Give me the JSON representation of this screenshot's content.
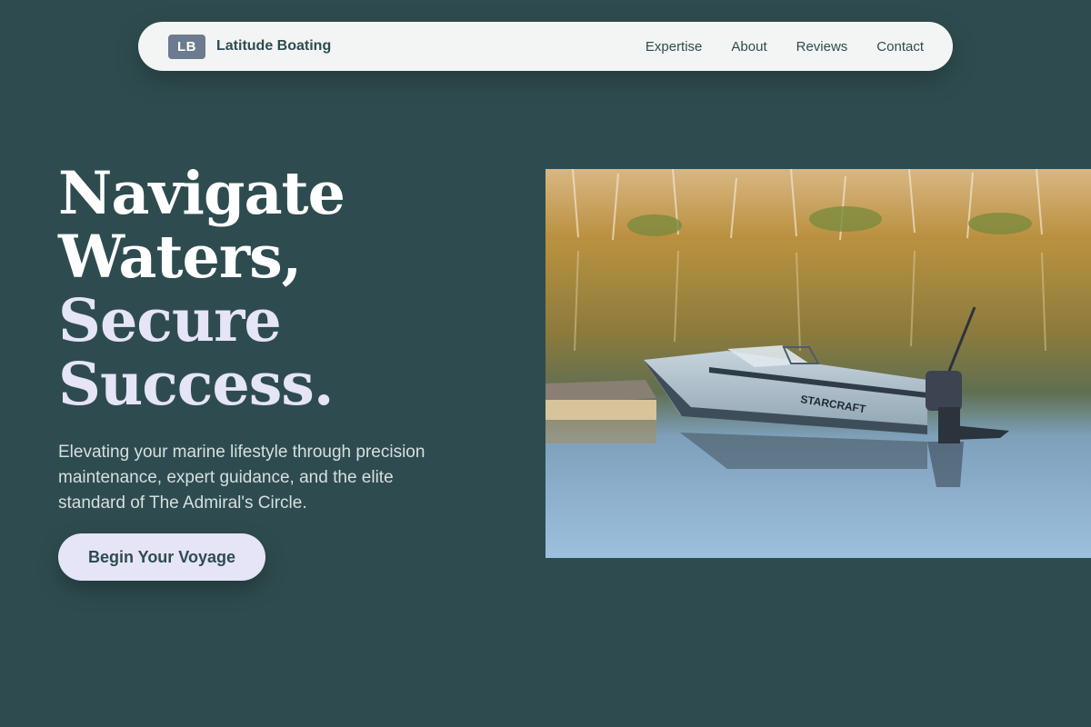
{
  "brand": {
    "initials": "LB",
    "name": "Latitude Boating"
  },
  "nav": {
    "links": [
      "Expertise",
      "About",
      "Reviews",
      "Contact"
    ]
  },
  "hero": {
    "title_lines": [
      "Navigate",
      "Waters,",
      "Secure",
      "Success."
    ],
    "subtitle": "Elevating your marine lifestyle through precision maintenance, expert guidance, and the elite standard of The Admiral's Circle.",
    "cta_label": "Begin Your Voyage",
    "image": {
      "subject": "motorboat on calm lake",
      "hull_text": "STARCRAFT"
    }
  },
  "colors": {
    "background": "#2e4c4f",
    "nav_bg": "#f3f5f4",
    "accent_lavender": "#e6e4f7",
    "logo_badge": "#6c7b8f"
  }
}
